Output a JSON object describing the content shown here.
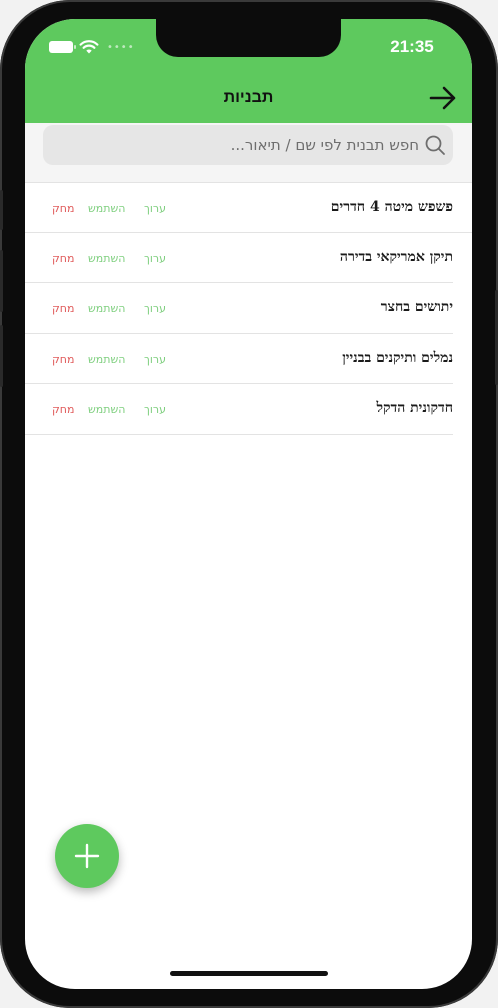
{
  "status": {
    "time": "21:35"
  },
  "header": {
    "title": "תבניות"
  },
  "search": {
    "placeholder": "חפש תבנית לפי שם / תיאור..."
  },
  "actions": {
    "edit": "ערוך",
    "use": "השתמש",
    "delete": "מחק"
  },
  "templates": [
    {
      "name": "פשפש מיטה 4 חדרים"
    },
    {
      "name": "תיקן אמריקאי בדירה"
    },
    {
      "name": "יתושים בחצר"
    },
    {
      "name": "נמלים ותיקנים בבניין"
    },
    {
      "name": "חדקונית הדקל"
    }
  ],
  "colors": {
    "accent": "#5ec95e",
    "delete": "#e05a5a",
    "action": "#7fcf7f"
  },
  "icons": {
    "back": "arrow-right-icon",
    "search": "search-icon",
    "add": "plus-icon"
  }
}
